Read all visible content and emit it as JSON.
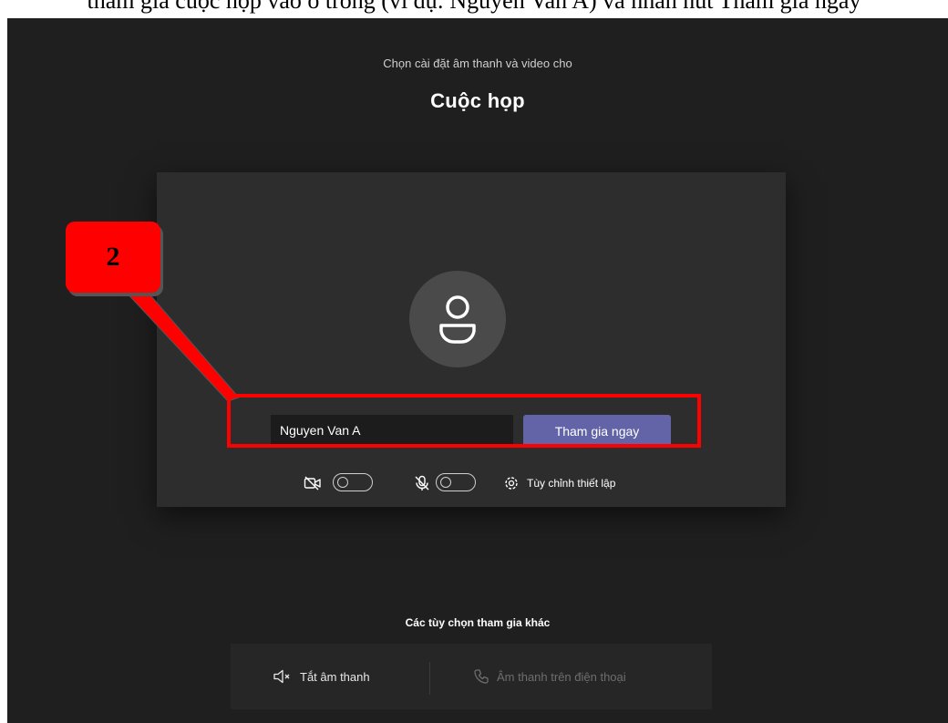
{
  "document": {
    "caption_fragment": "tham gia cuộc họp vào ô trống (ví dụ: Nguyen Van A) và nhấn nút Tham gia ngay"
  },
  "prejoin": {
    "subtitle": "Chọn cài đặt âm thanh và video cho",
    "title": "Cuộc họp",
    "name_input_value": "Nguyen Van A",
    "join_button_label": "Tham gia ngay",
    "camera_toggle_on": false,
    "mic_toggle_on": false,
    "settings_label": "Tùy chỉnh thiết lập"
  },
  "other_options": {
    "label": "Các tùy chọn tham gia khác",
    "audio_off_label": "Tắt âm thanh",
    "phone_audio_label": "Âm thanh trên điện thoại"
  },
  "annotation": {
    "step_number": "2"
  },
  "icons": {
    "avatar": "person-icon",
    "camera": "camera-off-icon",
    "mic": "mic-off-icon",
    "settings": "gear-icon",
    "audio_off": "speaker-muted-icon",
    "phone": "phone-icon"
  },
  "colors": {
    "background": "#1f1f1f",
    "card": "#2d2d2d",
    "accent": "#6264a7",
    "annotation": "#ff0000"
  }
}
